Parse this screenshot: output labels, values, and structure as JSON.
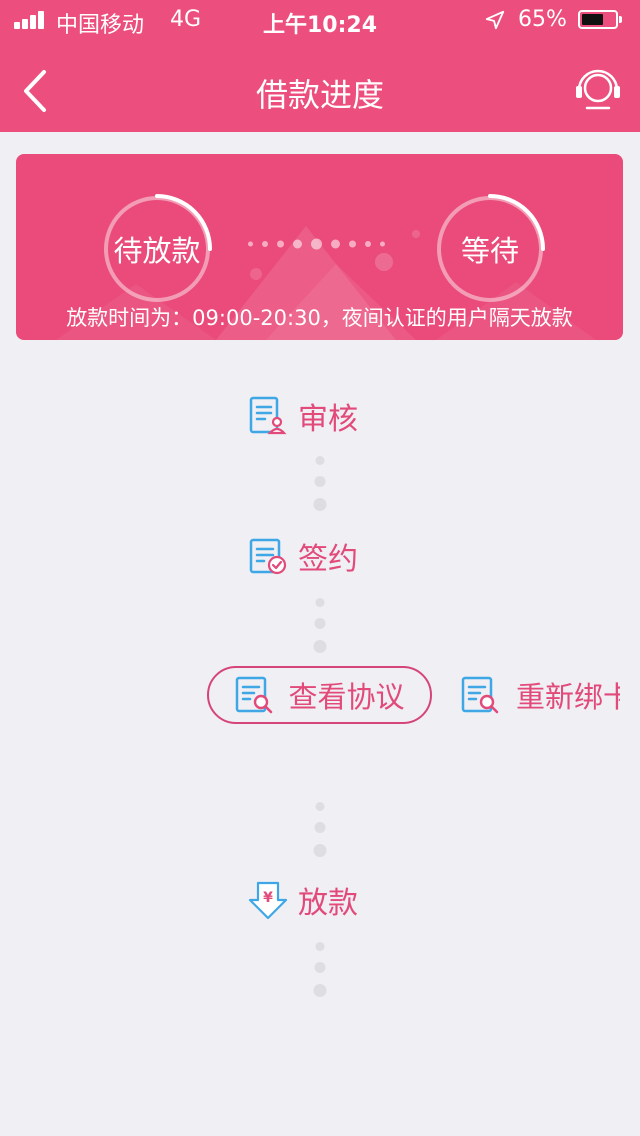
{
  "status_bar": {
    "carrier": "中国移动",
    "network": "4G",
    "time": "上午10:24",
    "battery_percent": "65%",
    "battery_level": 0.65,
    "icons": [
      "signal-icon",
      "location-arrow-icon",
      "battery-icon"
    ]
  },
  "nav": {
    "title": "借款进度",
    "back_icon": "chevron-left-icon",
    "service_icon": "headset-icon"
  },
  "banner": {
    "left_status": "待放款",
    "right_status": "等待",
    "note": "放款时间为：09:00-20:30，夜间认证的用户隔天放款"
  },
  "steps": {
    "review": "审核",
    "sign": "签约",
    "release": "放款"
  },
  "actions": {
    "view_protocol": "查看协议",
    "rebind_card": "重新绑卡"
  },
  "colors": {
    "primary": "#ec4f7d",
    "accent_text": "#e24a7a",
    "icon_blue": "#3fa7e6",
    "background": "#efeff4"
  }
}
